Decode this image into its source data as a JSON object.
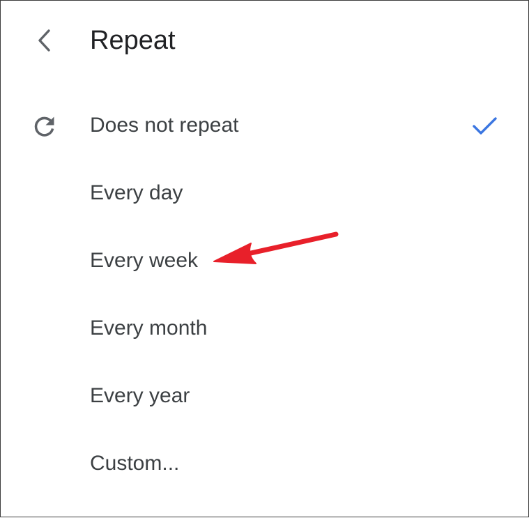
{
  "header": {
    "back_icon": "chevron-left-icon",
    "title": "Repeat"
  },
  "options": [
    {
      "label": "Does not repeat",
      "selected": true,
      "icon": "repeat-icon"
    },
    {
      "label": "Every day",
      "selected": false
    },
    {
      "label": "Every week",
      "selected": false
    },
    {
      "label": "Every month",
      "selected": false
    },
    {
      "label": "Every year",
      "selected": false
    },
    {
      "label": "Custom...",
      "selected": false
    }
  ],
  "colors": {
    "check": "#3b76e1",
    "annotation_arrow": "#e8202a",
    "icon_gray": "#5f6368",
    "text": "#3c4043"
  }
}
